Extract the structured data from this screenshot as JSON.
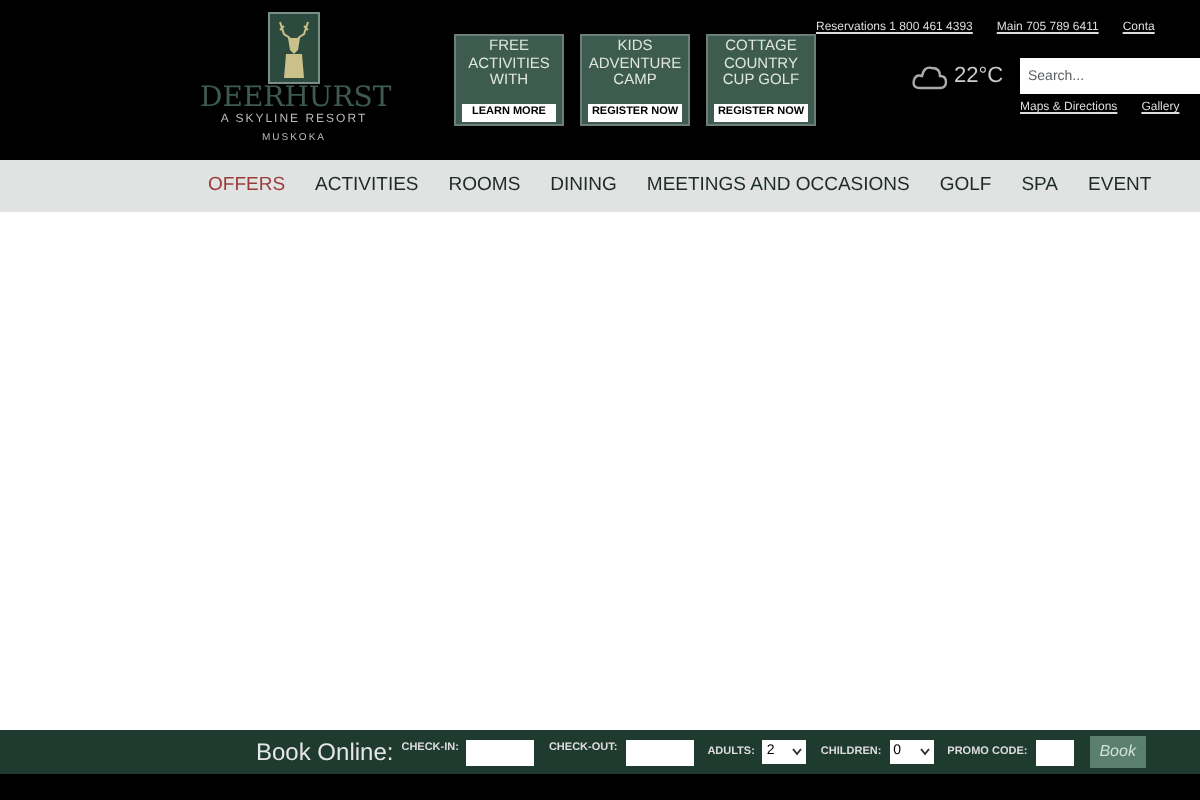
{
  "header": {
    "logo": {
      "name": "DEERHURST",
      "tagline": "A SKYLINE RESORT",
      "location": "MUSKOKA"
    },
    "promos": [
      {
        "text": "FREE ACTIVITIES WITH",
        "button": "LEARN MORE"
      },
      {
        "text": "KIDS ADVENTURE CAMP",
        "button": "REGISTER NOW"
      },
      {
        "text": "COTTAGE COUNTRY CUP GOLF",
        "button": "REGISTER NOW"
      }
    ],
    "top_links": [
      "Reservations 1 800 461 4393",
      "Main 705 789 6411",
      "Conta"
    ],
    "weather": {
      "temperature": "22°C"
    },
    "search": {
      "placeholder": "Search..."
    },
    "sub_links": [
      "Maps & Directions",
      "Gallery"
    ]
  },
  "nav": [
    {
      "label": "OFFERS",
      "selected": true
    },
    {
      "label": "ACTIVITIES",
      "selected": false
    },
    {
      "label": "ROOMS",
      "selected": false
    },
    {
      "label": "DINING",
      "selected": false
    },
    {
      "label": "MEETINGS AND OCCASIONS",
      "selected": false
    },
    {
      "label": "GOLF",
      "selected": false
    },
    {
      "label": "SPA",
      "selected": false
    },
    {
      "label": "EVENT",
      "selected": false
    }
  ],
  "booking": {
    "title": "Book Online:",
    "fields": [
      {
        "kind": "input",
        "label": "CHECK-IN:"
      },
      {
        "kind": "input",
        "label": "CHECK-OUT:"
      },
      {
        "kind": "select",
        "label": "ADULTS:",
        "value": "2"
      },
      {
        "kind": "select",
        "label": "CHILDREN:",
        "value": "0"
      },
      {
        "kind": "promo",
        "label": "PROMO CODE:"
      }
    ],
    "button": "Book"
  }
}
